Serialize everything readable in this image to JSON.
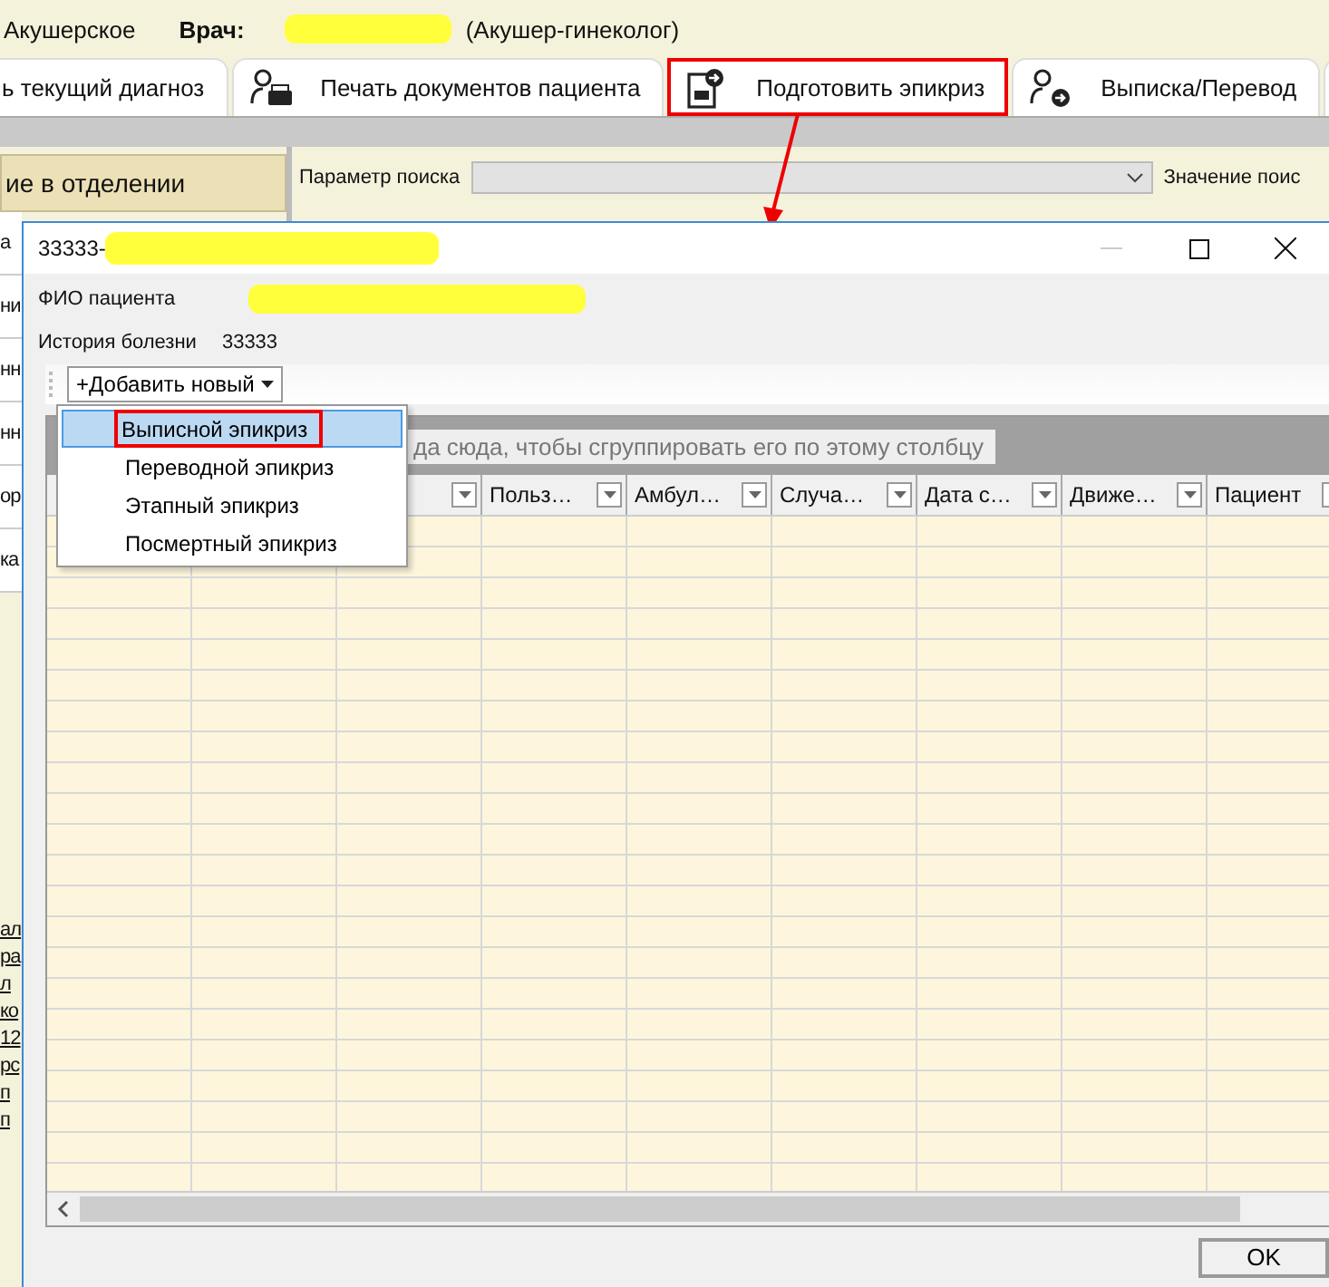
{
  "header": {
    "department": "Акушерское",
    "doctor_label": "Врач:",
    "doctor_role": "(Акушер-гинеколог)"
  },
  "tabs": [
    {
      "label": "ь текущий диагноз",
      "annotated": false
    },
    {
      "label": "Печать документов пациента",
      "annotated": false
    },
    {
      "label": "Подготовить эпикриз",
      "annotated": true
    },
    {
      "label": "Выписка/Перевод",
      "annotated": false
    }
  ],
  "left_panel": {
    "header": "ие в отделении",
    "items": [
      "а",
      "ни",
      "нн",
      "нн",
      "ор",
      "ка"
    ],
    "links": [
      "ал",
      "ра",
      "л",
      "ко",
      "12",
      "рс",
      "п",
      "п"
    ]
  },
  "search": {
    "label": "Параметр поиска",
    "value_label": "Значение поис"
  },
  "dialog": {
    "title": "33333-",
    "patient_label": "ФИО пациента",
    "history_label": "История болезни",
    "history_value": "33333",
    "add_button": "+Добавить новый",
    "menu": [
      {
        "label": "Выписной эпикриз",
        "selected": true,
        "annotated": true
      },
      {
        "label": "Переводной эпикриз",
        "selected": false,
        "annotated": false
      },
      {
        "label": "Этапный эпикриз",
        "selected": false,
        "annotated": false
      },
      {
        "label": "Посмертный эпикриз",
        "selected": false,
        "annotated": false
      }
    ],
    "group_hint": "да сюда, чтобы сгруппировать его по этому столбцу",
    "columns": [
      {
        "label": "Польз…"
      },
      {
        "label": "Амбул…"
      },
      {
        "label": "Случа…"
      },
      {
        "label": "Дата с…"
      },
      {
        "label": "Движе…"
      },
      {
        "label": "Пациент"
      }
    ],
    "ok_button": "OK"
  }
}
